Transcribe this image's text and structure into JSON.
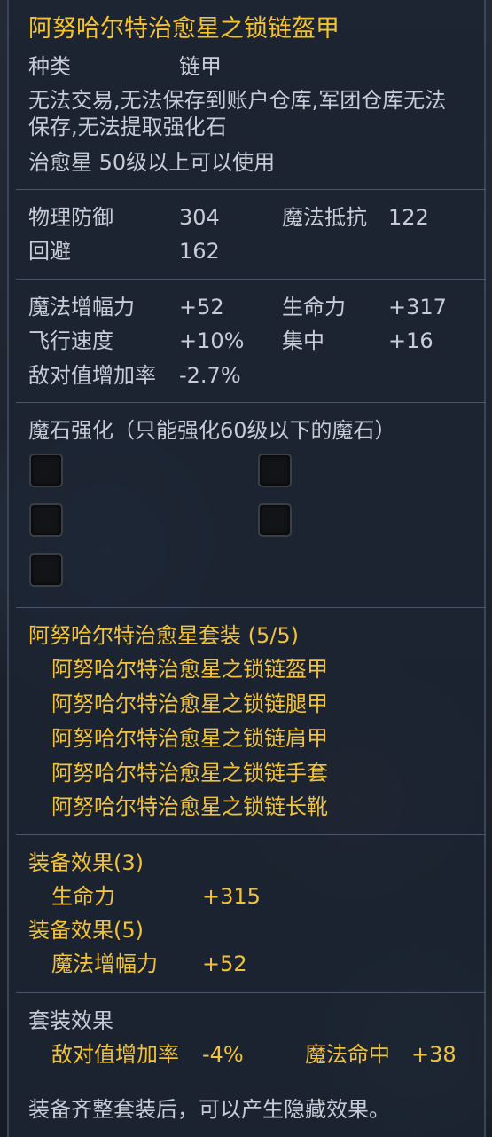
{
  "item": {
    "name": "阿努哈尔特治愈星之锁链盔甲",
    "type_label": "种类",
    "type_value": "链甲",
    "restrictions": "无法交易,无法保存到账户仓库,军团仓库无法保存,无法提取强化石",
    "requirement": "治愈星 50级以上可以使用"
  },
  "base_stats": [
    {
      "label": "物理防御",
      "value": "304"
    },
    {
      "label": "魔法抵抗",
      "value": "122"
    },
    {
      "label": "回避",
      "value": "162"
    }
  ],
  "bonus_stats": [
    {
      "label": "魔法增幅力",
      "value": "+52"
    },
    {
      "label": "生命力",
      "value": "+317"
    },
    {
      "label": "飞行速度",
      "value": "+10%"
    },
    {
      "label": "集中",
      "value": "+16"
    },
    {
      "label": "敌对值增加率",
      "value": "-2.7%"
    }
  ],
  "manastone": {
    "heading": "魔石强化（只能强化60级以下的魔石）",
    "slot_count": 5
  },
  "set": {
    "title": "阿努哈尔特治愈星套装 (5/5)",
    "pieces": [
      "阿努哈尔特治愈星之锁链盔甲",
      "阿努哈尔特治愈星之锁链腿甲",
      "阿努哈尔特治愈星之锁链肩甲",
      "阿努哈尔特治愈星之锁链手套",
      "阿努哈尔特治愈星之锁链长靴"
    ]
  },
  "effects": {
    "effect3_title": "装备效果(3)",
    "effect3_label": "生命力",
    "effect3_value": "+315",
    "effect5_title": "装备效果(5)",
    "effect5_label": "魔法增幅力",
    "effect5_value": "+52",
    "set_effect_title": "套装效果",
    "set_effect1_label": "敌对值增加率",
    "set_effect1_value": "-4%",
    "set_effect2_label": "魔法命中",
    "set_effect2_value": "+38"
  },
  "footer": "装备齐整套装后，可以产生隐藏效果。"
}
